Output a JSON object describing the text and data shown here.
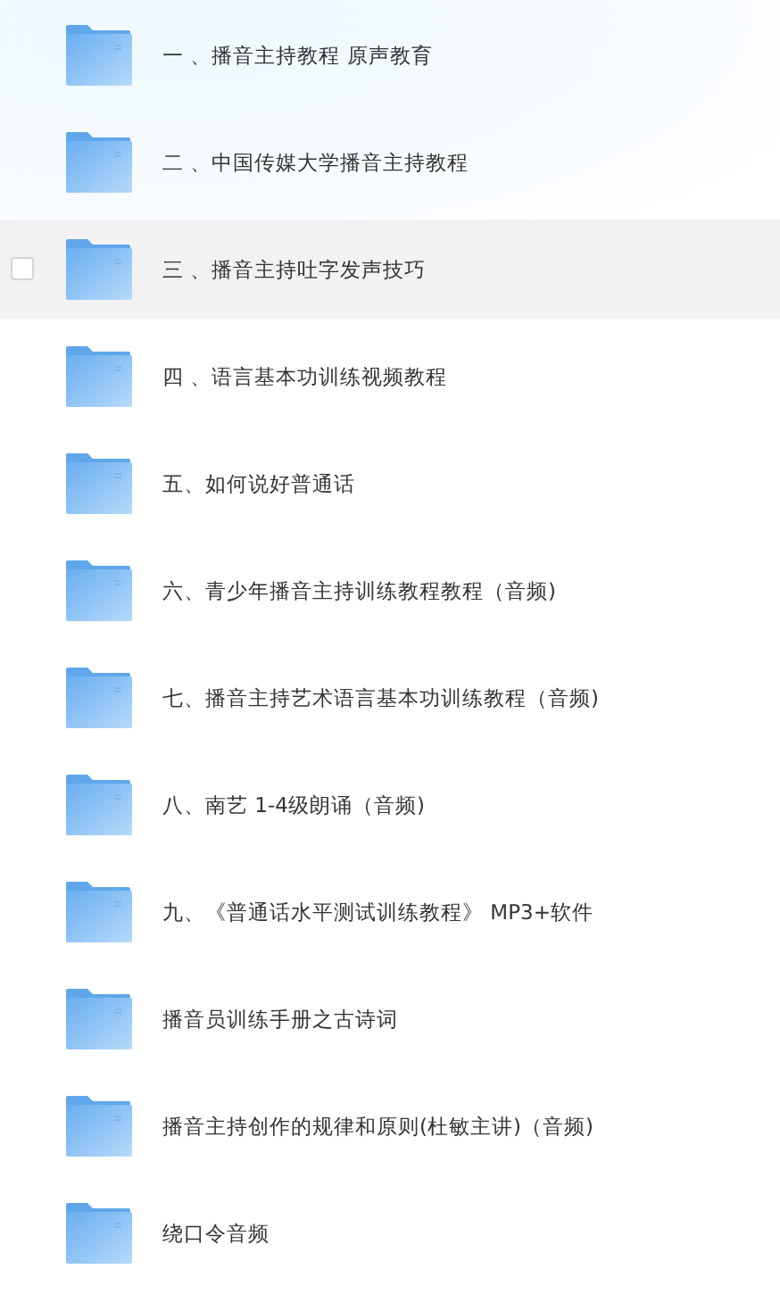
{
  "folders": [
    {
      "name": "一 、播音主持教程  原声教育",
      "hovered": false,
      "checked": false
    },
    {
      "name": "二 、中国传媒大学播音主持教程",
      "hovered": false,
      "checked": false
    },
    {
      "name": "三 、播音主持吐字发声技巧",
      "hovered": true,
      "checked": false
    },
    {
      "name": "四 、语言基本功训练视频教程",
      "hovered": false,
      "checked": false
    },
    {
      "name": "五、如何说好普通话",
      "hovered": false,
      "checked": false
    },
    {
      "name": "六、青少年播音主持训练教程教程（音频)",
      "hovered": false,
      "checked": false
    },
    {
      "name": "七、播音主持艺术语言基本功训练教程（音频)",
      "hovered": false,
      "checked": false
    },
    {
      "name": "八、南艺 1-4级朗诵（音频)",
      "hovered": false,
      "checked": false
    },
    {
      "name": "九、《普通话水平测试训练教程》 MP3+软件",
      "hovered": false,
      "checked": false
    },
    {
      "name": "播音员训练手册之古诗词",
      "hovered": false,
      "checked": false
    },
    {
      "name": "播音主持创作的规律和原则(杜敏主讲)（音频)",
      "hovered": false,
      "checked": false
    },
    {
      "name": "绕口令音频",
      "hovered": false,
      "checked": false
    }
  ]
}
